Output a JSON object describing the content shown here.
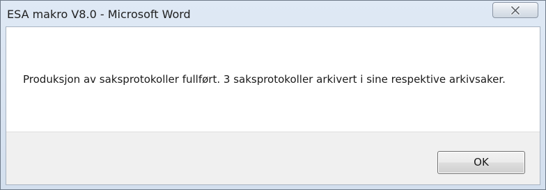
{
  "window": {
    "title": "ESA makro V8.0 - Microsoft Word",
    "close_icon": "close-icon"
  },
  "dialog": {
    "message": "Produksjon av saksprotokoller fullført.  3 saksprotokoller arkivert i sine respektive arkivsaker.",
    "ok_label": "OK"
  }
}
